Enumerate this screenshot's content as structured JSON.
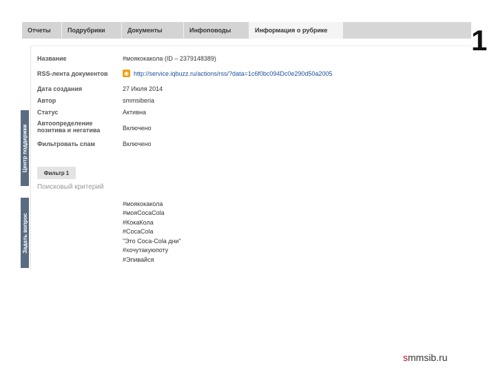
{
  "tabs": [
    "Отчеты",
    "Подрубрики",
    "Документы",
    "Инфоповоды",
    "Информация о рубрике"
  ],
  "top_right_glyph": "1",
  "side_tabs": [
    "Центр поддержки",
    "Задать вопрос"
  ],
  "info": {
    "name_label": "Название",
    "name_value": "#моякокакола",
    "name_id": "(ID – 2379148389)",
    "rss_label": "RSS-лента документов",
    "rss_url": "http://service.iqbuzz.ru/actions/rss/?data=1c6f0bc094Dc0e290d50a2005",
    "created_label": "Дата создания",
    "created_value": "27 Июля 2014",
    "author_label": "Автор",
    "author_value": "smmsiberia",
    "status_label": "Статус",
    "status_value": "Активна",
    "auto_label": "Автоопределение позитива и негатива",
    "auto_value": "Включено",
    "spam_label": "Фильтровать спам",
    "spam_value": "Включено"
  },
  "filter_button": "Фильтр 1",
  "criteria_title": "Поисковый критерий",
  "keywords": [
    "#моякокакола",
    "#мояCocaCola",
    "#КокаКола",
    "#CocaCola",
    "\"Это Coca-Cola дни\"",
    "#хочутакуюпоту",
    "#Эпивайся"
  ],
  "footer": {
    "first": "s",
    "rest": "mmsib.ru"
  }
}
